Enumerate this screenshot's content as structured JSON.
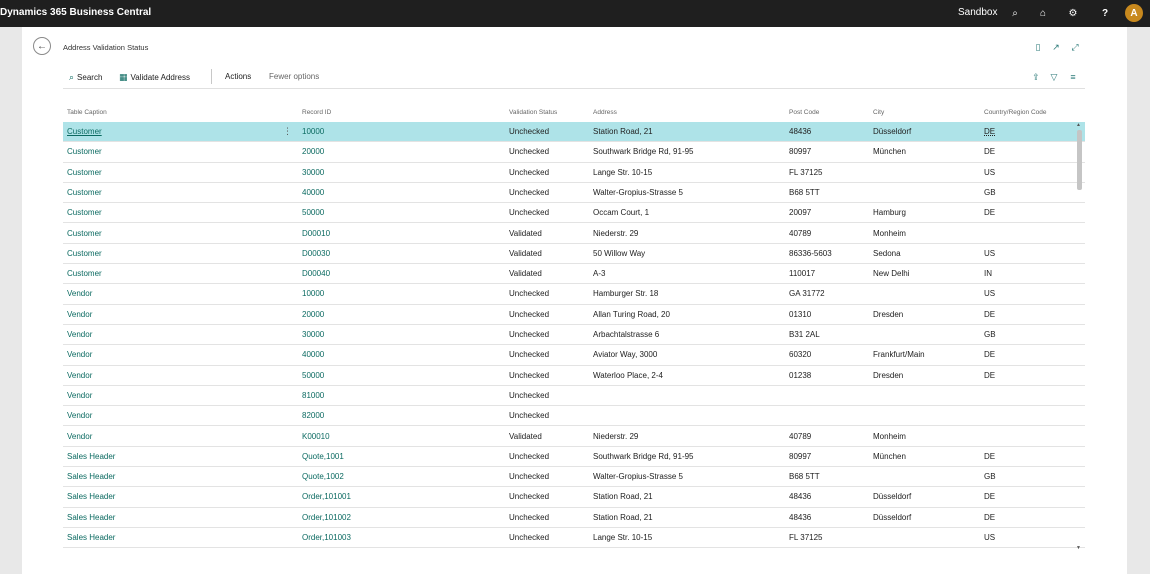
{
  "app": {
    "title": "Dynamics 365 Business Central",
    "environment": "Sandbox",
    "avatar_initial": "A"
  },
  "topbar_icons": [
    "search-icon",
    "bell-icon",
    "gear-icon",
    "help-icon"
  ],
  "page": {
    "title": "Address Validation Status"
  },
  "actions": {
    "search_label": "Search",
    "validate_label": "Validate Address",
    "actions_label": "Actions",
    "fewer_label": "Fewer options"
  },
  "columns": {
    "table_caption": "Table Caption",
    "record_id": "Record ID",
    "validation_status": "Validation Status",
    "address": "Address",
    "post_code": "Post Code",
    "city": "City",
    "country": "Country/Region Code"
  },
  "rows": [
    {
      "table": "Customer",
      "record": "10000",
      "status": "Unchecked",
      "address": "Station Road, 21",
      "post": "48436",
      "city": "Düsseldorf",
      "country": "DE"
    },
    {
      "table": "Customer",
      "record": "20000",
      "status": "Unchecked",
      "address": "Southwark Bridge Rd, 91-95",
      "post": "80997",
      "city": "München",
      "country": "DE"
    },
    {
      "table": "Customer",
      "record": "30000",
      "status": "Unchecked",
      "address": "Lange Str. 10-15",
      "post": "FL 37125",
      "city": "",
      "country": "US"
    },
    {
      "table": "Customer",
      "record": "40000",
      "status": "Unchecked",
      "address": "Walter-Gropius-Strasse 5",
      "post": "B68 5TT",
      "city": "",
      "country": "GB"
    },
    {
      "table": "Customer",
      "record": "50000",
      "status": "Unchecked",
      "address": "Occam Court, 1",
      "post": "20097",
      "city": "Hamburg",
      "country": "DE"
    },
    {
      "table": "Customer",
      "record": "D00010",
      "status": "Validated",
      "address": "Niederstr. 29",
      "post": "40789",
      "city": "Monheim",
      "country": ""
    },
    {
      "table": "Customer",
      "record": "D00030",
      "status": "Validated",
      "address": "50 Willow Way",
      "post": "86336-5603",
      "city": "Sedona",
      "country": "US"
    },
    {
      "table": "Customer",
      "record": "D00040",
      "status": "Validated",
      "address": "A-3",
      "post": "110017",
      "city": "New Delhi",
      "country": "IN"
    },
    {
      "table": "Vendor",
      "record": "10000",
      "status": "Unchecked",
      "address": "Hamburger Str. 18",
      "post": "GA 31772",
      "city": "",
      "country": "US"
    },
    {
      "table": "Vendor",
      "record": "20000",
      "status": "Unchecked",
      "address": "Allan Turing Road, 20",
      "post": "01310",
      "city": "Dresden",
      "country": "DE"
    },
    {
      "table": "Vendor",
      "record": "30000",
      "status": "Unchecked",
      "address": "Arbachtalstrasse 6",
      "post": "B31 2AL",
      "city": "",
      "country": "GB"
    },
    {
      "table": "Vendor",
      "record": "40000",
      "status": "Unchecked",
      "address": "Aviator Way, 3000",
      "post": "60320",
      "city": "Frankfurt/Main",
      "country": "DE"
    },
    {
      "table": "Vendor",
      "record": "50000",
      "status": "Unchecked",
      "address": "Waterloo Place, 2-4",
      "post": "01238",
      "city": "Dresden",
      "country": "DE"
    },
    {
      "table": "Vendor",
      "record": "81000",
      "status": "Unchecked",
      "address": "",
      "post": "",
      "city": "",
      "country": ""
    },
    {
      "table": "Vendor",
      "record": "82000",
      "status": "Unchecked",
      "address": "",
      "post": "",
      "city": "",
      "country": ""
    },
    {
      "table": "Vendor",
      "record": "K00010",
      "status": "Validated",
      "address": "Niederstr. 29",
      "post": "40789",
      "city": "Monheim",
      "country": ""
    },
    {
      "table": "Sales Header",
      "record": "Quote,1001",
      "status": "Unchecked",
      "address": "Southwark Bridge Rd, 91-95",
      "post": "80997",
      "city": "München",
      "country": "DE"
    },
    {
      "table": "Sales Header",
      "record": "Quote,1002",
      "status": "Unchecked",
      "address": "Walter-Gropius-Strasse 5",
      "post": "B68 5TT",
      "city": "",
      "country": "GB"
    },
    {
      "table": "Sales Header",
      "record": "Order,101001",
      "status": "Unchecked",
      "address": "Station Road, 21",
      "post": "48436",
      "city": "Düsseldorf",
      "country": "DE"
    },
    {
      "table": "Sales Header",
      "record": "Order,101002",
      "status": "Unchecked",
      "address": "Station Road, 21",
      "post": "48436",
      "city": "Düsseldorf",
      "country": "DE"
    },
    {
      "table": "Sales Header",
      "record": "Order,101003",
      "status": "Unchecked",
      "address": "Lange Str. 10-15",
      "post": "FL 37125",
      "city": "",
      "country": "US"
    }
  ]
}
